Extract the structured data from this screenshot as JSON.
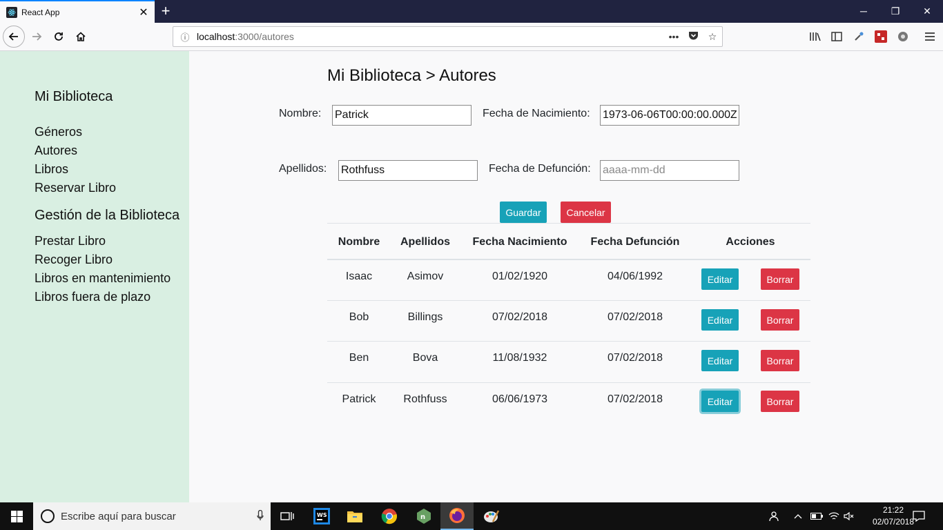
{
  "browser": {
    "tab_title": "React App",
    "url_host": "localhost",
    "url_path": ":3000/autores"
  },
  "sidebar": {
    "brand": "Mi Biblioteca",
    "section1_items": [
      "Géneros",
      "Autores",
      "Libros",
      "Reservar Libro"
    ],
    "section2_title": "Gestión de la Biblioteca",
    "section2_items": [
      "Prestar Libro",
      "Recoger Libro",
      "Libros en mantenimiento",
      "Libros fuera de plazo"
    ]
  },
  "main": {
    "title": "Mi Biblioteca > Autores",
    "form": {
      "nombre_label": "Nombre:",
      "nombre_value": "Patrick",
      "nacimiento_label": "Fecha de Nacimiento:",
      "nacimiento_value": "1973-06-06T00:00:00.000Z",
      "apellidos_label": "Apellidos:",
      "apellidos_value": "Rothfuss",
      "defuncion_label": "Fecha de Defunción:",
      "defuncion_placeholder": "aaaa-mm-dd",
      "save_label": "Guardar",
      "cancel_label": "Cancelar"
    },
    "table": {
      "headers": [
        "Nombre",
        "Apellidos",
        "Fecha Nacimiento",
        "Fecha Defunción",
        "Acciones"
      ],
      "rows": [
        {
          "nombre": "Isaac",
          "apellidos": "Asimov",
          "nacimiento": "01/02/1920",
          "defuncion": "04/06/1992",
          "edit": "Editar",
          "delete": "Borrar"
        },
        {
          "nombre": "Bob",
          "apellidos": "Billings",
          "nacimiento": "07/02/2018",
          "defuncion": "07/02/2018",
          "edit": "Editar",
          "delete": "Borrar"
        },
        {
          "nombre": "Ben",
          "apellidos": "Bova",
          "nacimiento": "11/08/1932",
          "defuncion": "07/02/2018",
          "edit": "Editar",
          "delete": "Borrar"
        },
        {
          "nombre": "Patrick",
          "apellidos": "Rothfuss",
          "nacimiento": "06/06/1973",
          "defuncion": "07/02/2018",
          "edit": "Editar",
          "delete": "Borrar"
        }
      ]
    }
  },
  "taskbar": {
    "search_placeholder": "Escribe aquí para buscar",
    "time": "21:22",
    "date": "02/07/2018"
  },
  "colors": {
    "info": "#17a2b8",
    "danger": "#dc3545",
    "sidebar_bg": "#d9efe2"
  }
}
